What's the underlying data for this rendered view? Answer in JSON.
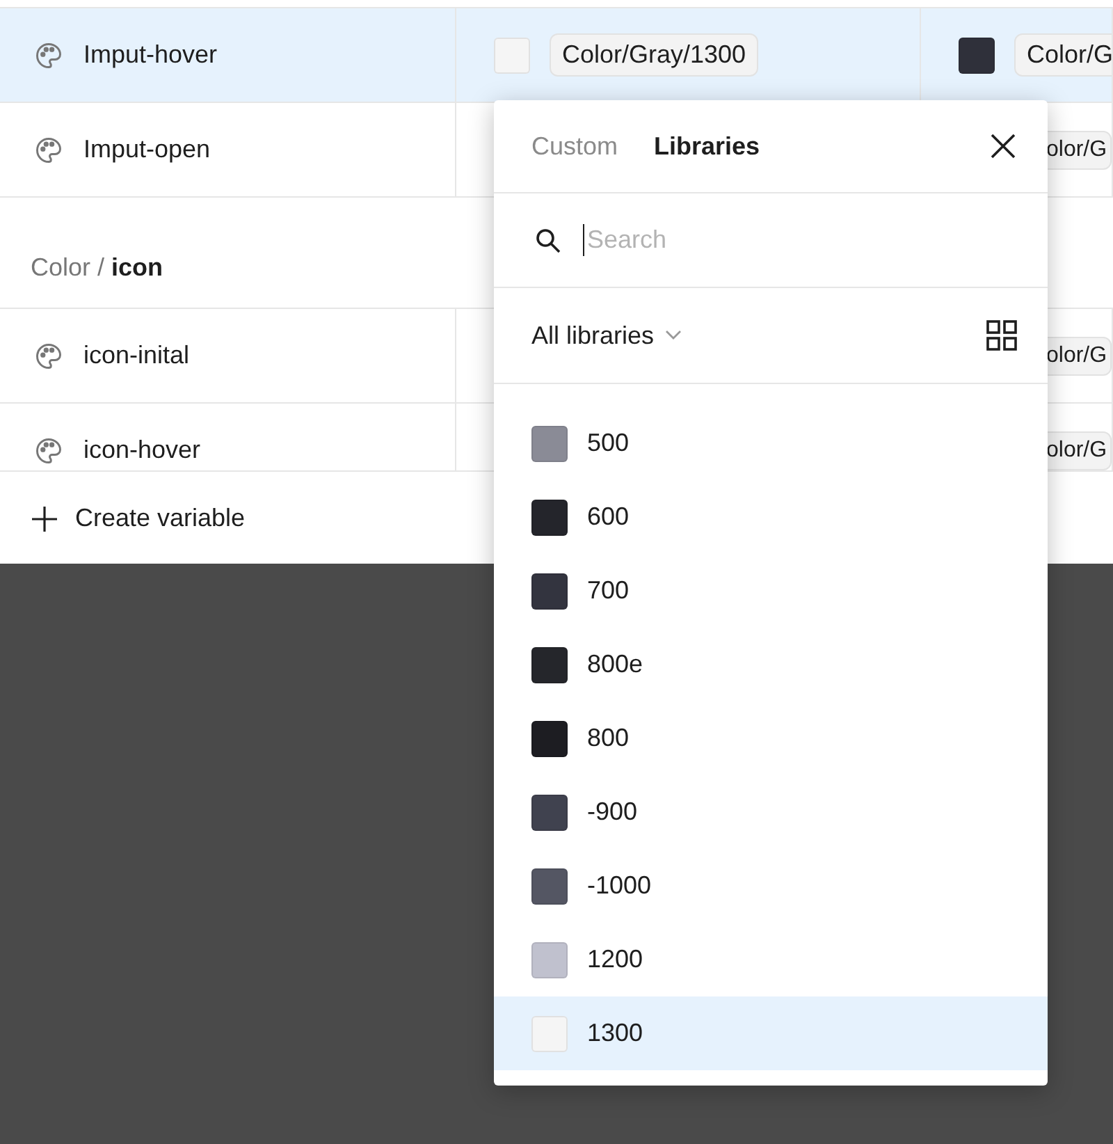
{
  "table": {
    "rows": [
      {
        "kind": "variable",
        "name": "Imput-hover",
        "selected": true,
        "cell_2": {
          "color": "#f5f5f5",
          "value": "Color/Gray/1300"
        },
        "cell_3": {
          "color": "#2f303a",
          "value": "Color/G"
        }
      },
      {
        "kind": "variable",
        "name": "Imput-open",
        "selected": false,
        "cell_3": {
          "value": "olor/G"
        }
      },
      {
        "kind": "group",
        "prefix": "Color / ",
        "name": "icon"
      },
      {
        "kind": "variable",
        "name": "icon-inital",
        "selected": false,
        "cell_3": {
          "value": "olor/G"
        }
      },
      {
        "kind": "variable",
        "name": "icon-hover",
        "selected": false,
        "cell_3": {
          "value": "olor/G"
        }
      }
    ],
    "footer": {
      "label": "Create variable"
    }
  },
  "popup": {
    "tabs": [
      {
        "label": "Custom",
        "selected": false
      },
      {
        "label": "Libraries",
        "selected": true
      }
    ],
    "search": {
      "placeholder": "Search"
    },
    "filter": {
      "label": "All libraries"
    },
    "colors": [
      {
        "label": "500",
        "color": "#8a8b96",
        "selected": false
      },
      {
        "label": "600",
        "color": "#24252b",
        "selected": false
      },
      {
        "label": "700",
        "color": "#33343f",
        "selected": false
      },
      {
        "label": "800e",
        "color": "#25262b",
        "selected": false
      },
      {
        "label": "800",
        "color": "#1d1d22",
        "selected": false
      },
      {
        "label": "-900",
        "color": "#40424f",
        "selected": false
      },
      {
        "label": "-1000",
        "color": "#545663",
        "selected": false
      },
      {
        "label": "1200",
        "color": "#c0c1ce",
        "selected": false
      },
      {
        "label": "1300",
        "color": "#f5f5f5",
        "selected": true
      }
    ]
  }
}
